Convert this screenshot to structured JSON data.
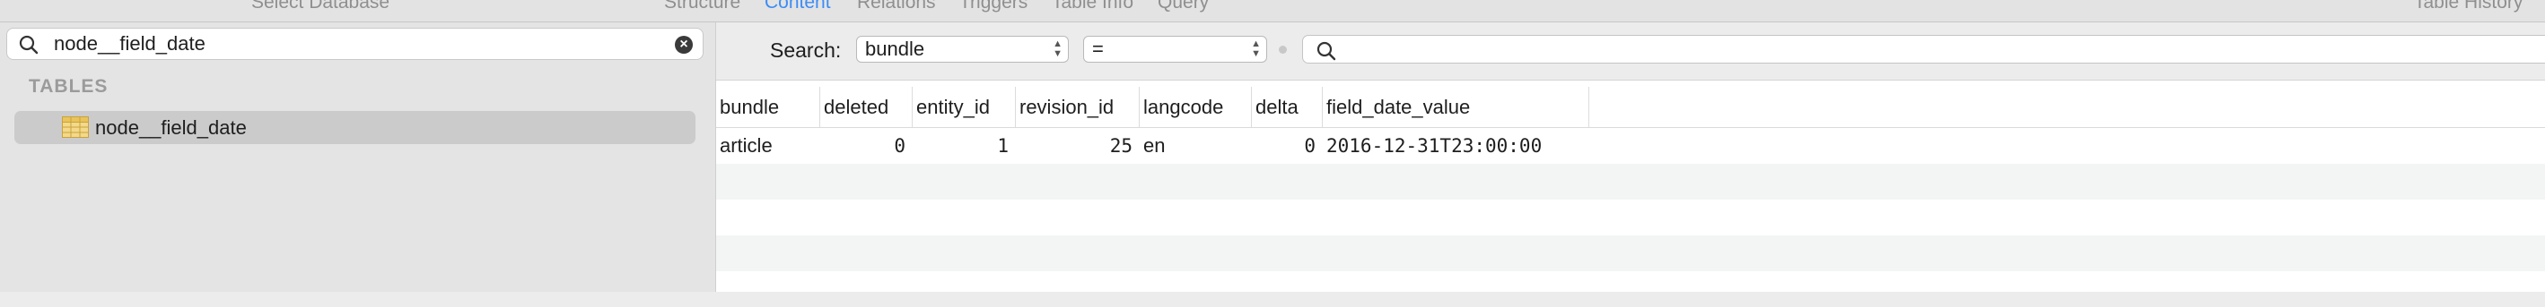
{
  "toolbar": {
    "select_database": "Select Database",
    "tabs": [
      "Structure",
      "Content",
      "Relations",
      "Triggers",
      "Table Info",
      "Query"
    ],
    "active_tab": "Content",
    "table_history": "Table History"
  },
  "sidebar": {
    "filter_value": "node__field_date",
    "section_title": "TABLES",
    "items": [
      {
        "label": "node__field_date",
        "selected": true
      }
    ]
  },
  "search": {
    "label": "Search:",
    "field_select": "bundle",
    "operator_select": "=",
    "value": ""
  },
  "grid": {
    "columns": [
      "bundle",
      "deleted",
      "entity_id",
      "revision_id",
      "langcode",
      "delta",
      "field_date_value"
    ],
    "rows": [
      [
        "article",
        "0",
        "1",
        "25",
        "en",
        "0",
        "2016-12-31T23:00:00"
      ]
    ]
  },
  "colors": {
    "accent": "#3c8cf4",
    "selection": "#cbcbcb",
    "table_icon": "#e8c45a"
  }
}
